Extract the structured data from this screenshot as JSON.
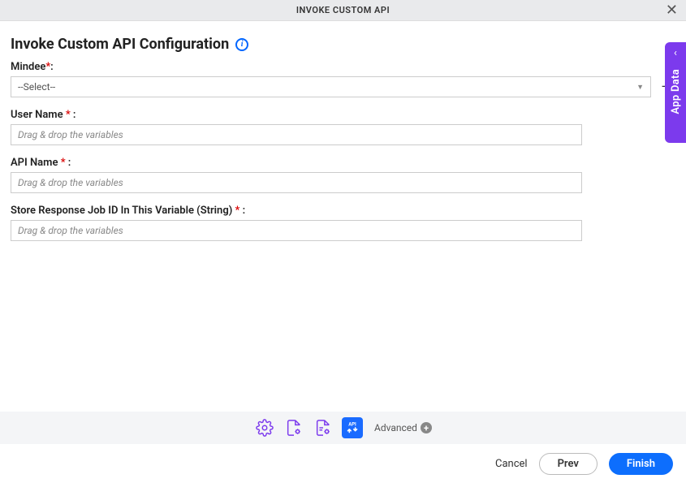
{
  "header": {
    "title": "INVOKE CUSTOM API"
  },
  "page": {
    "title": "Invoke Custom API Configuration"
  },
  "form": {
    "mindee": {
      "label": "Mindee",
      "required_marker": "*",
      "colon": ":",
      "selected": "--Select--"
    },
    "username": {
      "label": "User Name",
      "required_marker": "*",
      "colon": ":",
      "placeholder": "Drag & drop the variables",
      "value": ""
    },
    "apiname": {
      "label": "API Name",
      "required_marker": "*",
      "colon": ":",
      "placeholder": "Drag & drop the variables",
      "value": ""
    },
    "jobid": {
      "label": "Store Response Job ID In This Variable (String)",
      "required_marker": "*",
      "colon": ":",
      "placeholder": "Drag & drop the variables",
      "value": ""
    }
  },
  "toolbar": {
    "advanced_label": "Advanced"
  },
  "footer": {
    "cancel": "Cancel",
    "prev": "Prev",
    "finish": "Finish"
  },
  "side_tab": {
    "label": "App Data"
  }
}
